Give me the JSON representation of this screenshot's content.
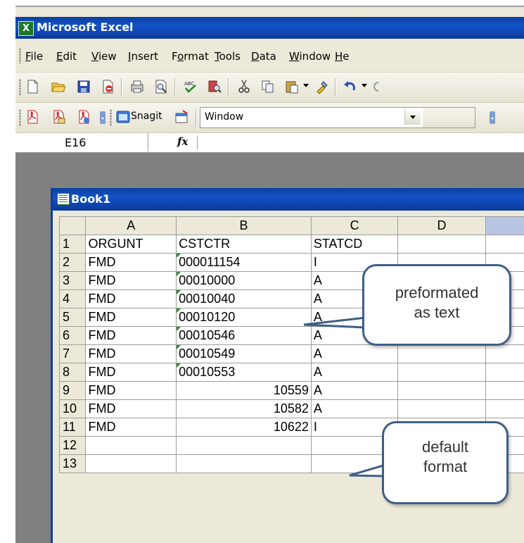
{
  "app": {
    "title": "Microsoft Excel"
  },
  "menu": [
    {
      "pre": "",
      "key": "F",
      "post": "ile"
    },
    {
      "pre": "",
      "key": "E",
      "post": "dit"
    },
    {
      "pre": "",
      "key": "V",
      "post": "iew"
    },
    {
      "pre": "",
      "key": "I",
      "post": "nsert"
    },
    {
      "pre": "F",
      "key": "o",
      "post": "rmat"
    },
    {
      "pre": "",
      "key": "T",
      "post": "ools"
    },
    {
      "pre": "",
      "key": "D",
      "post": "ata"
    },
    {
      "pre": "",
      "key": "W",
      "post": "indow"
    },
    {
      "pre": "",
      "key": "H",
      "post": "e"
    }
  ],
  "toolbar2": {
    "snagit_label": "Snagit",
    "window_combo_value": "Window"
  },
  "formula_bar": {
    "name_box": "E16",
    "fx_label": "fx",
    "formula": ""
  },
  "workbook": {
    "title": "Book1",
    "columns": [
      "A",
      "B",
      "C",
      "D"
    ],
    "rows": [
      {
        "n": "1",
        "a": "ORGUNT",
        "b": "CSTCTR",
        "b_text": true,
        "b_marker": false,
        "c": "STATCD",
        "d": ""
      },
      {
        "n": "2",
        "a": "FMD",
        "b": "000011154",
        "b_text": true,
        "b_marker": true,
        "c": "I",
        "d": ""
      },
      {
        "n": "3",
        "a": "FMD",
        "b": "00010000",
        "b_text": true,
        "b_marker": true,
        "c": "A",
        "d": ""
      },
      {
        "n": "4",
        "a": "FMD",
        "b": "00010040",
        "b_text": true,
        "b_marker": true,
        "c": "A",
        "d": ""
      },
      {
        "n": "5",
        "a": "FMD",
        "b": "00010120",
        "b_text": true,
        "b_marker": true,
        "c": "A",
        "d": ""
      },
      {
        "n": "6",
        "a": "FMD",
        "b": "00010546",
        "b_text": true,
        "b_marker": true,
        "c": "A",
        "d": ""
      },
      {
        "n": "7",
        "a": "FMD",
        "b": "00010549",
        "b_text": true,
        "b_marker": true,
        "c": "A",
        "d": ""
      },
      {
        "n": "8",
        "a": "FMD",
        "b": "00010553",
        "b_text": true,
        "b_marker": true,
        "c": "A",
        "d": ""
      },
      {
        "n": "9",
        "a": "FMD",
        "b": "10559",
        "b_text": false,
        "b_marker": false,
        "c": "A",
        "d": ""
      },
      {
        "n": "10",
        "a": "FMD",
        "b": "10582",
        "b_text": false,
        "b_marker": false,
        "c": "A",
        "d": ""
      },
      {
        "n": "11",
        "a": "FMD",
        "b": "10622",
        "b_text": false,
        "b_marker": false,
        "c": "I",
        "d": ""
      },
      {
        "n": "12",
        "a": "",
        "b": "",
        "b_text": true,
        "b_marker": false,
        "c": "",
        "d": ""
      },
      {
        "n": "13",
        "a": "",
        "b": "",
        "b_text": true,
        "b_marker": false,
        "c": "",
        "d": ""
      }
    ]
  },
  "callouts": {
    "text_note": {
      "line1": "preformated",
      "line2": "as text"
    },
    "default_note": {
      "line1": "default",
      "line2": "format"
    }
  },
  "colors": {
    "titlebar": "#0a3fa0",
    "text_marker": "#2e8b2e",
    "callout_border": "#3f5f86"
  }
}
